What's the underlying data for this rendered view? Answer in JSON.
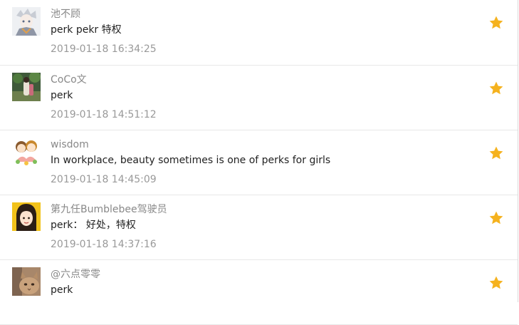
{
  "accent_color": "#f5b21e",
  "comments": [
    {
      "user": "池不顾",
      "text": "perk pekr 特权",
      "time": "2019-01-18 16:34:25",
      "avatar_icon": "anime-character-avatar",
      "star_icon": "star-icon"
    },
    {
      "user": "CoCo文",
      "text": "perk",
      "time": "2019-01-18 14:51:12",
      "avatar_icon": "photo-avatar",
      "star_icon": "star-icon"
    },
    {
      "user": "wisdom",
      "text": "In workplace, beauty sometimes is one of perks for girls",
      "time": "2019-01-18 14:45:09",
      "avatar_icon": "cartoon-couple-avatar",
      "star_icon": "star-icon"
    },
    {
      "user": "第九任Bumblebee驾驶员",
      "text": "perk：  好处，特权",
      "time": "2019-01-18 14:37:16",
      "avatar_icon": "cartoon-girl-avatar",
      "star_icon": "star-icon"
    },
    {
      "user": "@六点零零",
      "text": "perk",
      "time": "",
      "avatar_icon": "cat-photo-avatar",
      "star_icon": "star-icon"
    }
  ]
}
